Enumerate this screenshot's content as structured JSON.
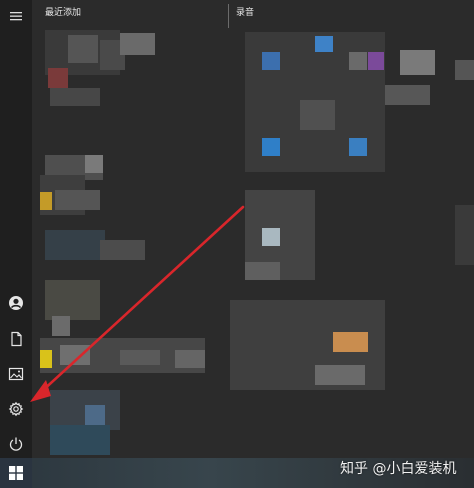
{
  "start_menu": {
    "menu_icon": "hamburger-icon",
    "headers": {
      "recently_added": "最近添加",
      "tiles_group": "录音"
    },
    "rail_icons": [
      "user-icon",
      "documents-icon",
      "pictures-icon",
      "settings-icon",
      "power-icon",
      "windows-logo-icon"
    ]
  },
  "watermark": {
    "text": "知乎 @小白爱装机"
  },
  "annotation": {
    "arrow_color": "#d9262b",
    "points_to": "settings-icon"
  }
}
